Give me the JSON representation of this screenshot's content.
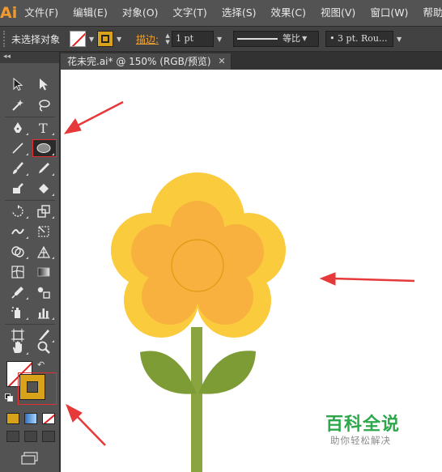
{
  "app": {
    "logo": "Ai"
  },
  "menu": [
    "文件(F)",
    "编辑(E)",
    "对象(O)",
    "文字(T)",
    "选择(S)",
    "效果(C)",
    "视图(V)",
    "窗口(W)",
    "帮助("
  ],
  "control_bar": {
    "selection_label": "未选择对象",
    "stroke_label": "描边:",
    "stroke_weight": "1 pt",
    "profile_label": "等比",
    "brush_label": "• 3 pt. Rou..."
  },
  "document_tab": {
    "title": "花未完.ai* @ 150% (RGB/预览)",
    "close": "✕"
  },
  "tools_panel": {
    "collapse": "◂◂"
  },
  "watermark": {
    "title": "百科全说",
    "subtitle": "助你轻松解决"
  },
  "colors": {
    "petal_outer": "#fbcb3e",
    "petal_inner": "#f8b13f",
    "center_stroke": "#d99a10",
    "stem": "#8aa53f",
    "leaf": "#7d9c36",
    "arrow": "#e63939",
    "stroke_swatch": "#d9a21b"
  }
}
